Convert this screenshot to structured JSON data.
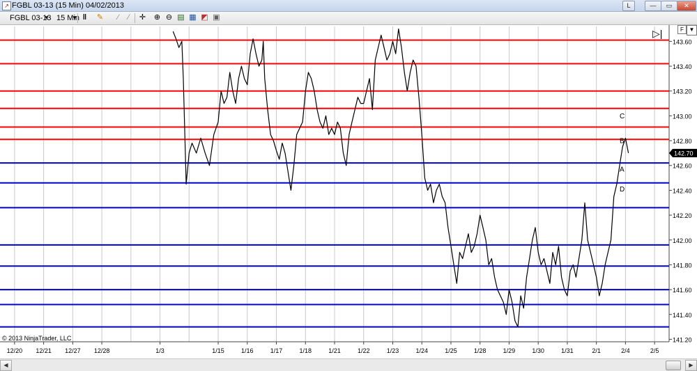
{
  "window": {
    "title": "FGBL 03-13 (15 Min)  04/02/2013",
    "buttons": [
      {
        "name": "link-button",
        "label": "L"
      },
      {
        "name": "minimize-button",
        "label": "—"
      },
      {
        "name": "maximize-button",
        "label": "▭"
      },
      {
        "name": "close-button",
        "label": "✕"
      }
    ]
  },
  "toolbar": {
    "instrument": "FGBL 03-13",
    "interval": "15 Min",
    "icons": [
      "bar-type-icon",
      "pencil-icon",
      "drawing-tool-icon",
      "crosshair-icon",
      "zoom-in-icon",
      "zoom-out-icon",
      "properties-icon",
      "indicators-icon",
      "strategies-icon",
      "chart-trader-icon"
    ]
  },
  "chart_right_icons": {
    "f": "F",
    "menu": "▼",
    "scroll_end": "▷|"
  },
  "copyright": "© 2013 NinjaTrader, LLC",
  "colors": {
    "resistance": "#ff0000",
    "support": "#0000cc",
    "price": "#000000",
    "grid": "#c8c8c8",
    "last_price_bg": "#000000"
  },
  "chart_data": {
    "type": "line",
    "instrument": "FGBL 03-13",
    "interval": "15 Min",
    "yticks": [
      141.2,
      141.4,
      141.6,
      141.8,
      142.0,
      142.2,
      142.4,
      142.6,
      142.8,
      143.0,
      143.2,
      143.4,
      143.6
    ],
    "ytick_labels": [
      "141.20",
      "141.40",
      "141.60",
      "141.80",
      "142.00",
      "142.20",
      "142.40",
      "142.60",
      "142.80",
      "143.00",
      "143.20",
      "143.40",
      "143.60"
    ],
    "ylim": [
      141.18,
      143.72
    ],
    "x_labels": [
      "12/20",
      "12/21",
      "12/27",
      "12/28",
      "1/3",
      "1/15",
      "1/16",
      "1/17",
      "1/18",
      "1/21",
      "1/22",
      "1/23",
      "1/24",
      "1/25",
      "1/28",
      "1/29",
      "1/30",
      "1/31",
      "2/1",
      "2/4",
      "2/5"
    ],
    "x_label_positions": [
      0,
      1,
      2,
      3,
      5,
      7,
      8,
      9,
      10,
      11,
      12,
      13,
      14,
      15,
      16,
      17,
      18,
      19,
      20,
      21,
      22
    ],
    "xlim": [
      -0.5,
      22.5
    ],
    "last_price": 142.7,
    "last_price_label": "142.70",
    "resistance_levels": [
      143.61,
      143.42,
      143.2,
      143.06,
      142.91,
      142.81
    ],
    "support_levels": [
      142.62,
      142.46,
      142.26,
      141.96,
      141.79,
      141.6,
      141.48,
      141.3
    ],
    "annotations": [
      {
        "text": "C",
        "x": 20.8,
        "y": 142.98
      },
      {
        "text": "B",
        "x": 20.8,
        "y": 142.78
      },
      {
        "text": "A",
        "x": 20.8,
        "y": 142.55
      },
      {
        "text": "D",
        "x": 20.8,
        "y": 142.39
      }
    ],
    "price_series": {
      "x": [
        5.45,
        5.55,
        5.65,
        5.75,
        5.8,
        5.9,
        6.0,
        6.1,
        6.25,
        6.4,
        6.55,
        6.7,
        6.85,
        7.0,
        7.1,
        7.2,
        7.3,
        7.4,
        7.5,
        7.6,
        7.7,
        7.8,
        7.9,
        8.0,
        8.1,
        8.2,
        8.3,
        8.4,
        8.5,
        8.55,
        8.6,
        8.7,
        8.8,
        8.9,
        9.0,
        9.1,
        9.2,
        9.3,
        9.4,
        9.5,
        9.6,
        9.7,
        9.8,
        9.9,
        10.0,
        10.1,
        10.2,
        10.3,
        10.4,
        10.5,
        10.6,
        10.7,
        10.8,
        10.9,
        11.0,
        11.1,
        11.2,
        11.3,
        11.4,
        11.5,
        11.6,
        11.7,
        11.8,
        11.9,
        12.0,
        12.1,
        12.2,
        12.3,
        12.4,
        12.5,
        12.6,
        12.7,
        12.8,
        12.9,
        13.0,
        13.1,
        13.2,
        13.3,
        13.4,
        13.5,
        13.6,
        13.7,
        13.8,
        13.9,
        14.0,
        14.1,
        14.2,
        14.3,
        14.4,
        14.5,
        14.6,
        14.7,
        14.8,
        14.9,
        15.0,
        15.1,
        15.2,
        15.3,
        15.4,
        15.5,
        15.6,
        15.7,
        15.8,
        15.9,
        16.0,
        16.1,
        16.2,
        16.3,
        16.4,
        16.5,
        16.6,
        16.7,
        16.8,
        16.9,
        17.0,
        17.1,
        17.2,
        17.3,
        17.4,
        17.5,
        17.6,
        17.7,
        17.8,
        17.9,
        18.0,
        18.1,
        18.2,
        18.3,
        18.4,
        18.5,
        18.6,
        18.7,
        18.8,
        18.9,
        19.0,
        19.1,
        19.2,
        19.3,
        19.4,
        19.5,
        19.6,
        19.7,
        19.8,
        19.9,
        20.0,
        20.1,
        20.2,
        20.3,
        20.4,
        20.5,
        20.6,
        20.7,
        20.8,
        20.9,
        21.0,
        21.1,
        21.2,
        21.3,
        21.4,
        21.5,
        21.6,
        21.7,
        21.8,
        21.9,
        22.0,
        22.1,
        22.2,
        22.3,
        22.4
      ],
      "y": [
        143.68,
        143.62,
        143.55,
        143.6,
        143.3,
        142.45,
        142.7,
        142.78,
        142.7,
        142.82,
        142.7,
        142.6,
        142.85,
        142.95,
        143.2,
        143.1,
        143.15,
        143.35,
        143.2,
        143.1,
        143.3,
        143.4,
        143.3,
        143.25,
        143.5,
        143.62,
        143.5,
        143.4,
        143.45,
        143.6,
        143.3,
        143.05,
        142.85,
        142.8,
        142.72,
        142.65,
        142.78,
        142.7,
        142.55,
        142.4,
        142.6,
        142.85,
        142.9,
        142.95,
        143.2,
        143.35,
        143.3,
        143.2,
        143.05,
        142.95,
        142.9,
        143.0,
        142.85,
        142.9,
        142.85,
        142.95,
        142.9,
        142.7,
        142.6,
        142.85,
        142.95,
        143.05,
        143.15,
        143.1,
        143.1,
        143.2,
        143.3,
        143.05,
        143.45,
        143.55,
        143.65,
        143.55,
        143.45,
        143.5,
        143.6,
        143.5,
        143.7,
        143.55,
        143.35,
        143.2,
        143.35,
        143.45,
        143.4,
        143.15,
        142.85,
        142.5,
        142.4,
        142.45,
        142.3,
        142.4,
        142.45,
        142.35,
        142.3,
        142.1,
        141.95,
        141.8,
        141.65,
        141.9,
        141.85,
        141.95,
        142.05,
        141.9,
        141.95,
        142.05,
        142.2,
        142.1,
        142.0,
        141.8,
        141.85,
        141.7,
        141.6,
        141.55,
        141.5,
        141.4,
        141.6,
        141.5,
        141.35,
        141.3,
        141.55,
        141.45,
        141.7,
        141.85,
        142.0,
        142.1,
        141.9,
        141.8,
        141.85,
        141.75,
        141.65,
        141.9,
        141.8,
        141.95,
        141.7,
        141.6,
        141.55,
        141.75,
        141.8,
        141.7,
        141.85,
        142.0,
        142.3,
        142.0,
        141.9,
        141.8,
        141.7,
        141.55,
        141.65,
        141.8,
        141.9,
        142.0,
        142.35,
        142.45,
        142.6,
        142.75,
        142.82,
        142.7
      ]
    }
  }
}
